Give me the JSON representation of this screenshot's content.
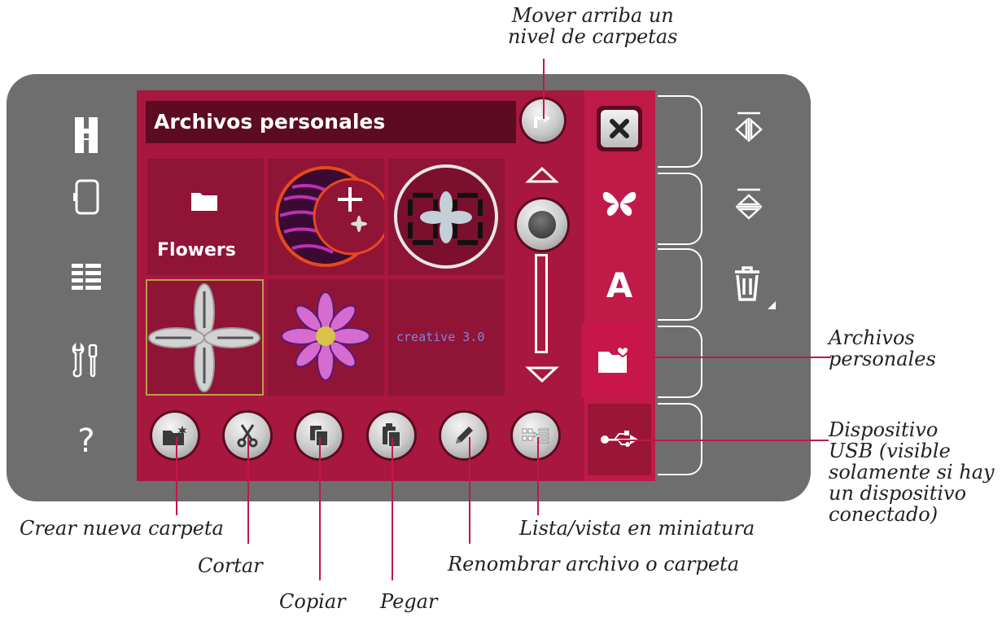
{
  "screen": {
    "title": "Archivos personales",
    "folder_label": "Flowers",
    "tile_text": "creative 3.0"
  },
  "callouts": {
    "up_folder_line1": "Mover arriba un",
    "up_folder_line2": "nivel de carpetas",
    "personal_files_line1": "Archivos",
    "personal_files_line2": "personales",
    "usb_line1": "Dispositivo",
    "usb_line2": "USB (visible",
    "usb_line3": "solamente si hay",
    "usb_line4": "un dispositivo",
    "usb_line5": "conectado)",
    "new_folder": "Crear nueva carpeta",
    "cut": "Cortar",
    "copy": "Copiar",
    "paste": "Pegar",
    "rename": "Renombrar archivo o carpeta",
    "list_view": "Lista/vista en miniatura"
  },
  "side_icons": {
    "help": "?"
  },
  "colors": {
    "screen": "#a7173f",
    "title_bar": "#5c0b22",
    "callout_line": "#c0184a",
    "bezel": "#6e6e6e"
  }
}
